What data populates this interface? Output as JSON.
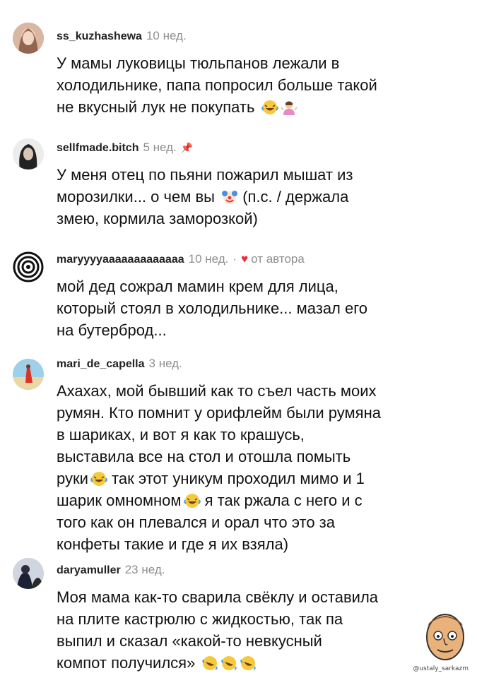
{
  "comments": [
    {
      "username": "ss_kuzhashewa",
      "time": "10 нед.",
      "lines": [
        "У мамы луковицы тюльпанов лежали в",
        "холодильнике, папа попросил больше такой",
        "не вкусный лук не покупать"
      ],
      "emojis": [
        "laughing-icon",
        "shrug-icon"
      ]
    },
    {
      "username": "sellfmade.bitch",
      "time": "5 нед.",
      "pinned": true,
      "lines": [
        "У меня отец по пьяни пожарил мышат из",
        "морозилки... о чем вы",
        "змею, кормила заморозкой)"
      ],
      "line2_after_emoji": "(п.с. / держала",
      "emojis": [
        "clown-icon"
      ]
    },
    {
      "username": "maryyyyaaaaaaaaaaaaa",
      "time": "10 нед.",
      "author_tag": "от автора",
      "lines": [
        "мой дед сожрал мамин крем для лица,",
        "который стоял в холодильнике... мазал его",
        "на бутерброд..."
      ]
    },
    {
      "username": "mari_de_capella",
      "time": "3 нед.",
      "lines": [
        "Ахахах, мой бывший как то съел часть моих",
        "румян. Кто помнит у орифлейм были румяна",
        "в шариках, и вот я как то крашусь,",
        "выставила все на стол и отошла помыть",
        "руки",
        "шарик омномном",
        "того как он плевался и орал что это за",
        "конфеты такие и где я их взяла)"
      ],
      "line5_after_emoji": "так этот уникум проходил мимо и 1",
      "line6_after_emoji": "я так ржала с него и с"
    },
    {
      "username": "daryamuller",
      "time": "23 нед.",
      "lines": [
        "Моя мама как-то сварила свёклу и оставила",
        "на плите кастрюлю с жидкостью, так па",
        "выпил и сказал «какой-то невкусный",
        "компот получился»"
      ],
      "emojis": [
        "rofl-icon",
        "rofl-icon",
        "rofl-icon"
      ]
    }
  ],
  "watermark": "@ustaly_sarkazm"
}
